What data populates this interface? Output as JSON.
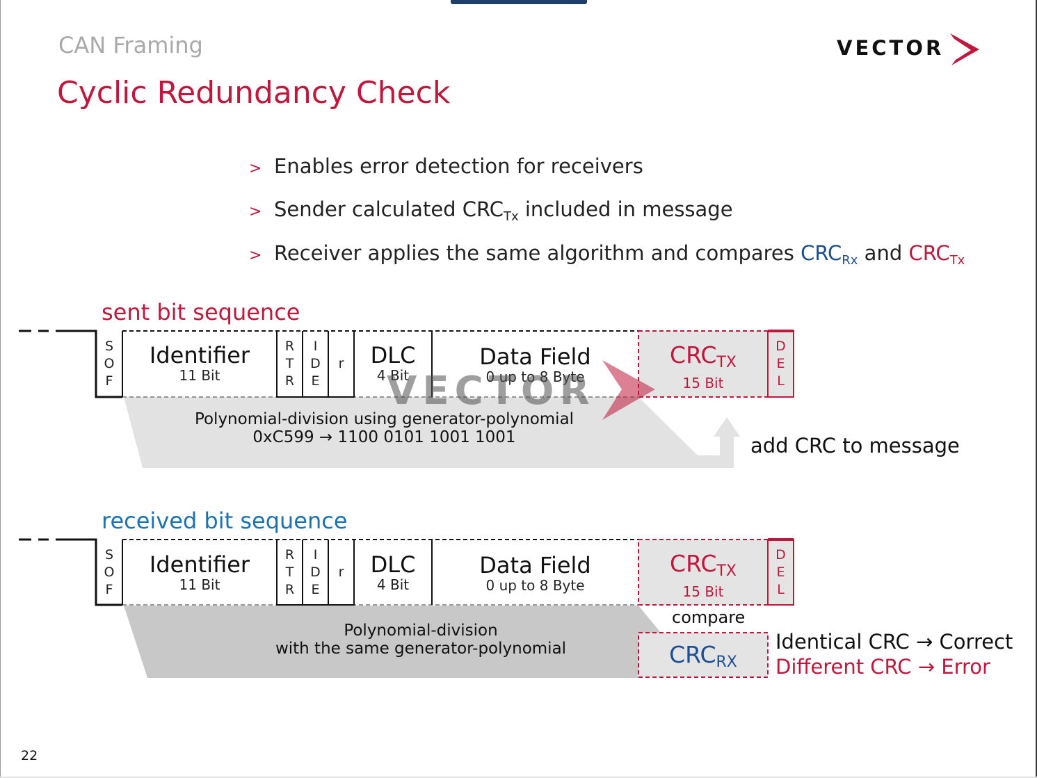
{
  "slide": {
    "section": "CAN Framing",
    "title": "Cyclic Redundancy Check",
    "logo_text": "VECTOR",
    "watermark_text": "VECTOR",
    "page_number": "22"
  },
  "bullets": [
    {
      "marker": ">",
      "text": "Enables error detection for receivers"
    },
    {
      "marker": ">",
      "before": "Sender calculated CRC",
      "sub": "Tx",
      "after": " included in message"
    },
    {
      "marker": ">",
      "before": "Receiver applies the same algorithm and compares ",
      "crc1": "CRC",
      "crc1_sub": "Rx",
      "mid": " and ",
      "crc2": "CRC",
      "crc2_sub": "Tx"
    }
  ],
  "sent": {
    "label": "sent bit sequence",
    "sof": [
      "S",
      "O",
      "F"
    ],
    "identifier": {
      "name": "Identifier",
      "sub": "11 Bit"
    },
    "rtr": [
      "R",
      "T",
      "R"
    ],
    "ide": [
      "I",
      "D",
      "E"
    ],
    "r": "r",
    "dlc": {
      "name": "DLC",
      "sub": "4 Bit"
    },
    "data": {
      "name": "Data Field",
      "sub": "0 up to 8 Byte"
    },
    "crc": {
      "name": "CRC",
      "name_sub": "TX",
      "sub": "15 Bit"
    },
    "del": [
      "D",
      "E",
      "L"
    ],
    "division_line1": "Polynomial-division using generator-polynomial",
    "division_line2": "0xC599 → 1100 0101 1001 1001",
    "add_crc": "add CRC to message"
  },
  "received": {
    "label": "received bit sequence",
    "sof": [
      "S",
      "O",
      "F"
    ],
    "identifier": {
      "name": "Identifier",
      "sub": "11 Bit"
    },
    "rtr": [
      "R",
      "T",
      "R"
    ],
    "ide": [
      "I",
      "D",
      "E"
    ],
    "r": "r",
    "dlc": {
      "name": "DLC",
      "sub": "4 Bit"
    },
    "data": {
      "name": "Data Field",
      "sub": "0 up to 8 Byte"
    },
    "crc": {
      "name": "CRC",
      "name_sub": "TX",
      "sub": "15 Bit"
    },
    "del": [
      "D",
      "E",
      "L"
    ],
    "division_line1": "Polynomial-division",
    "division_line2": "with the same generator-polynomial",
    "compare": "compare",
    "crc_rx": {
      "name": "CRC",
      "sub": "RX"
    },
    "result_ok": "Identical CRC → Correct",
    "result_err": "Different CRC → Error"
  },
  "colors": {
    "accent_red": "#c0183c",
    "accent_blue": "#1b4f91",
    "label_blue": "#1b72b5",
    "gray_section": "#a9a9a9"
  }
}
